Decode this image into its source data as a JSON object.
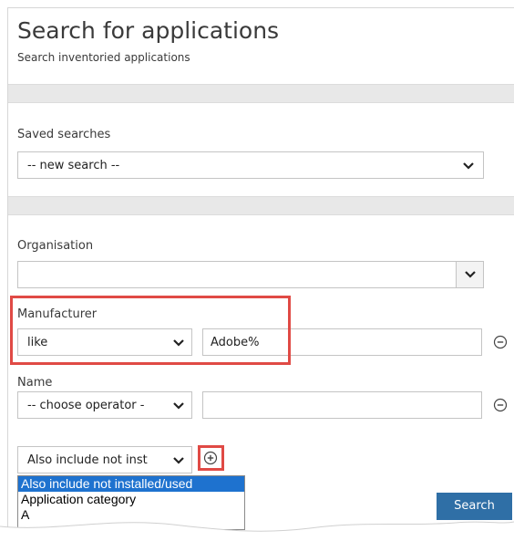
{
  "page": {
    "title": "Search for applications",
    "subtitle": "Search inventoried applications"
  },
  "saved_searches": {
    "label": "Saved searches",
    "selected": "-- new search --"
  },
  "organisation": {
    "label": "Organisation",
    "selected": ""
  },
  "criteria": [
    {
      "label": "Manufacturer",
      "operator": "like",
      "value": "Adobe%"
    },
    {
      "label": "Name",
      "operator": "-- choose operator -",
      "value": ""
    }
  ],
  "add_criteria": {
    "selected": "Also include not inst",
    "options": [
      "Also include not installed/used",
      "Application category",
      "A"
    ],
    "highlighted_index": 0
  },
  "search_button": {
    "label": "Search"
  },
  "colors": {
    "highlight": "#e04a45",
    "primary_button": "#2f6fa6",
    "selected_option": "#1e72cf"
  }
}
